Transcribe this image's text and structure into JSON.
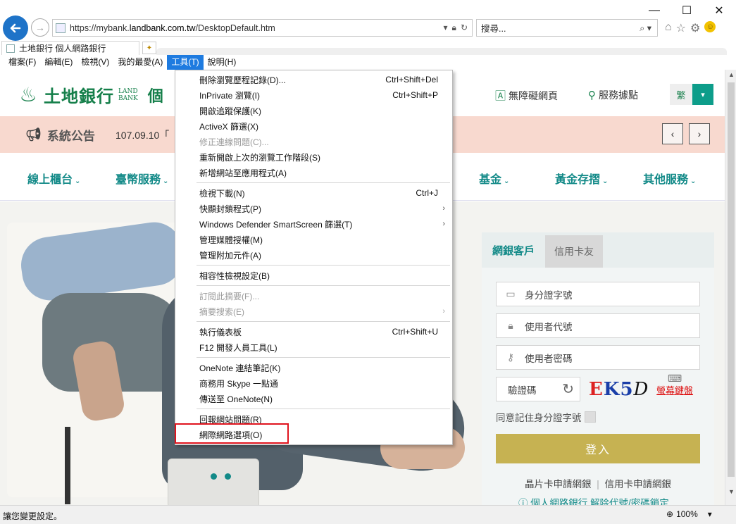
{
  "browser": {
    "url_prefix": "https://mybank.",
    "url_domain": "landbank.com.tw",
    "url_path": "/DesktopDefault.htm",
    "search_placeholder": "搜尋...",
    "tab_title": "土地銀行 個人網路銀行",
    "minimize": "—",
    "maximize": "☐",
    "close": "✕"
  },
  "menubar": {
    "items": [
      "檔案(F)",
      "編輯(E)",
      "檢視(V)",
      "我的最愛(A)",
      "工具(T)",
      "說明(H)"
    ],
    "active_index": 4
  },
  "site": {
    "brand": "土地銀行",
    "brand_en_1": "LAND",
    "brand_en_2": "BANK",
    "brand_suffix": "個",
    "accessibility": "無障礙網頁",
    "locations": "服務據點",
    "lang": "繁"
  },
  "notice": {
    "title": "系統公告",
    "text": "107.09.10「"
  },
  "nav": {
    "items": [
      "線上櫃台",
      "臺幣服務",
      "基金",
      "黃金存摺",
      "其他服務"
    ]
  },
  "login": {
    "tab_active": "網銀客戶",
    "tab_inactive": "信用卡友",
    "id_placeholder": "身分證字號",
    "user_placeholder": "使用者代號",
    "pass_placeholder": "使用者密碼",
    "captcha_label": "驗證碼",
    "captcha_chars": [
      "E",
      "K",
      "5",
      "D"
    ],
    "keyboard_label": "螢幕鍵盤",
    "remember": "同意記住身分證字號",
    "login_button": "登入",
    "link_chip": "晶片卡申請網銀",
    "link_sep": "|",
    "link_card": "信用卡申請網銀",
    "link_help": "個人網路銀行 解除代號/密碼鎖定"
  },
  "tools_menu": {
    "items": [
      {
        "label": "刪除瀏覽歷程記錄(D)...",
        "shortcut": "Ctrl+Shift+Del"
      },
      {
        "label": "InPrivate 瀏覽(I)",
        "shortcut": "Ctrl+Shift+P"
      },
      {
        "label": "開啟追蹤保護(K)",
        "shortcut": ""
      },
      {
        "label": "ActiveX 篩選(X)",
        "shortcut": ""
      },
      {
        "label": "修正連線問題(C)...",
        "shortcut": "",
        "disabled": true
      },
      {
        "label": "重新開啟上次的瀏覽工作階段(S)",
        "shortcut": ""
      },
      {
        "label": "新增網站至應用程式(A)",
        "shortcut": ""
      },
      {
        "label": "檢視下載(N)",
        "shortcut": "Ctrl+J"
      },
      {
        "label": "快顯封鎖程式(P)",
        "shortcut": "",
        "submenu": true
      },
      {
        "label": "Windows Defender SmartScreen 篩選(T)",
        "shortcut": "",
        "submenu": true
      },
      {
        "label": "管理媒體授權(M)",
        "shortcut": ""
      },
      {
        "label": "管理附加元件(A)",
        "shortcut": ""
      },
      {
        "label": "相容性檢視設定(B)",
        "shortcut": ""
      },
      {
        "label": "訂閱此摘要(F)...",
        "shortcut": "",
        "disabled": true
      },
      {
        "label": "摘要搜索(E)",
        "shortcut": "",
        "disabled": true,
        "submenu": true
      },
      {
        "label": "執行儀表板",
        "shortcut": "Ctrl+Shift+U"
      },
      {
        "label": "F12 開發人員工具(L)",
        "shortcut": ""
      },
      {
        "label": "OneNote 連結筆記(K)",
        "shortcut": ""
      },
      {
        "label": "商務用 Skype 一點通",
        "shortcut": ""
      },
      {
        "label": "傳送至 OneNote(N)",
        "shortcut": ""
      },
      {
        "label": "回報網站問題(R)",
        "shortcut": ""
      },
      {
        "label": "網際網路選項(O)",
        "shortcut": "",
        "highlighted": true
      }
    ]
  },
  "statusbar": {
    "text": "讓您變更設定。",
    "zoom": "100%"
  },
  "colors": {
    "brand_green": "#157f4a",
    "teal": "#138a88",
    "notice_bg": "#f8d9cf",
    "login_gold": "#c6b252",
    "menu_active": "#1e7be0",
    "highlight_red": "#e0141e"
  }
}
